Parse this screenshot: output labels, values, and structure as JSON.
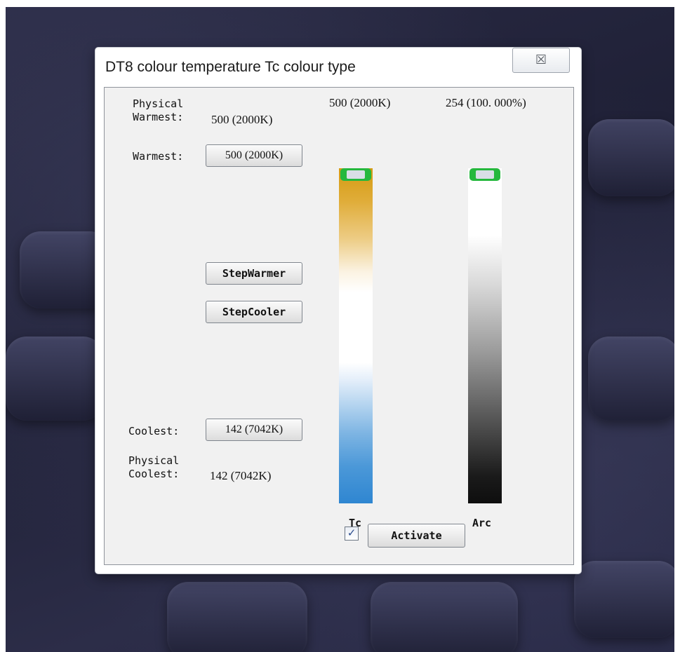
{
  "dialog": {
    "title": "DT8 colour temperature Tc colour type",
    "close_glyph": "☒"
  },
  "labels": {
    "physical_warmest": "Physical\nWarmest:",
    "physical_warmest_value": "500 (2000K)",
    "warmest": "Warmest:",
    "coolest": "Coolest:",
    "physical_coolest": "Physical\nCoolest:",
    "physical_coolest_value": "142 (7042K)"
  },
  "buttons": {
    "warmest": "500 (2000K)",
    "step_warmer": "StepWarmer",
    "step_cooler": "StepCooler",
    "coolest": "142 (7042K)",
    "activate": "Activate"
  },
  "sliders": {
    "tc": {
      "value_label": "500 (2000K)",
      "axis_label": "Tc",
      "colors": {
        "warm": "#d59b12",
        "cool": "#2f86d1"
      }
    },
    "arc": {
      "value_label": "254 (100. 000%)",
      "axis_label": "Arc",
      "colors": {
        "top": "#ffffff",
        "bottom": "#0e0e0e"
      }
    },
    "thumb_color": "#25b83d"
  },
  "activate_checkbox": {
    "checked": true,
    "glyph": "✓"
  }
}
